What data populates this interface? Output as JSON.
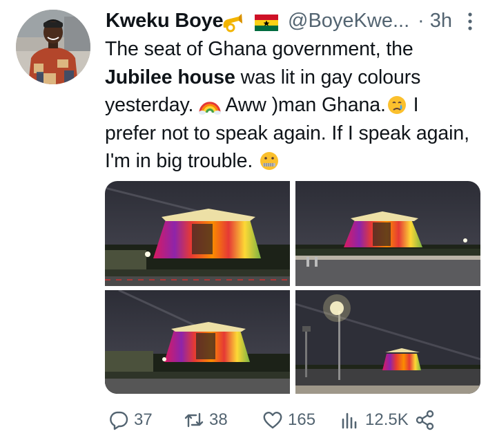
{
  "tweet": {
    "author_name": "Kweku Boye",
    "handle": "@BoyeKwe...",
    "separator": "·",
    "time": "3h",
    "text_parts": [
      "The seat of Ghana government, the ",
      "Jubilee house",
      " was lit in gay colours yesterday. ",
      " Aww )man Ghana.",
      " I prefer not to speak again. If I speak again, I'm in big trouble."
    ],
    "emojis": [
      "postal-horn",
      "ghana-flag",
      "rainbow",
      "crying-face",
      "zipper-mouth-face"
    ]
  },
  "media": {
    "images": [
      "jubilee-house-rainbow-1",
      "jubilee-house-rainbow-2",
      "jubilee-house-rainbow-3",
      "jubilee-house-rainbow-4"
    ]
  },
  "actions": {
    "replies": "37",
    "retweets": "38",
    "likes": "165",
    "views": "12.5K"
  },
  "colors": {
    "text": "#0f1419",
    "secondary": "#536471",
    "ghana_red": "#ce1126",
    "ghana_gold": "#fcd116",
    "ghana_green": "#006b3f"
  }
}
